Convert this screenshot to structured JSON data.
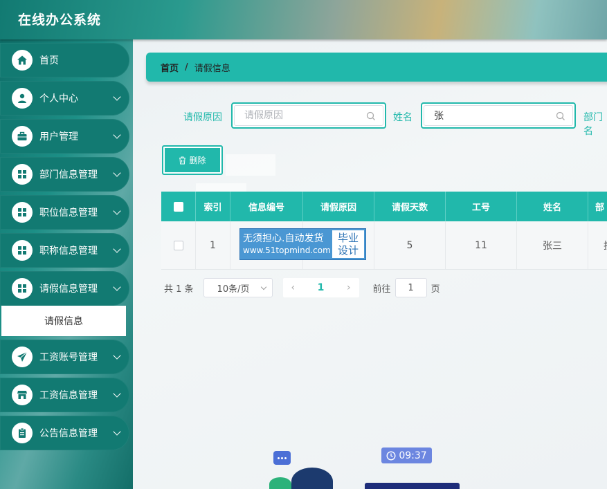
{
  "app": {
    "title": "在线办公系统"
  },
  "sidebar": {
    "items": [
      {
        "label": "首页",
        "icon": "home-icon",
        "has_arrow": false
      },
      {
        "label": "个人中心",
        "icon": "user-icon",
        "has_arrow": true
      },
      {
        "label": "用户管理",
        "icon": "briefcase-icon",
        "has_arrow": true
      },
      {
        "label": "部门信息管理",
        "icon": "grid-icon",
        "has_arrow": true
      },
      {
        "label": "职位信息管理",
        "icon": "grid-icon",
        "has_arrow": true
      },
      {
        "label": "职称信息管理",
        "icon": "grid-icon",
        "has_arrow": true
      },
      {
        "label": "请假信息管理",
        "icon": "grid-icon",
        "has_arrow": true
      },
      {
        "label": "工资账号管理",
        "icon": "paper-plane-icon",
        "has_arrow": true
      },
      {
        "label": "工资信息管理",
        "icon": "store-icon",
        "has_arrow": true
      },
      {
        "label": "公告信息管理",
        "icon": "clipboard-icon",
        "has_arrow": true
      }
    ],
    "active_submenu": "请假信息"
  },
  "breadcrumb": {
    "home": "首页",
    "separator": "/",
    "current": "请假信息"
  },
  "search": {
    "reason_label": "请假原因",
    "reason_placeholder": "请假原因",
    "reason_value": "",
    "name_label": "姓名",
    "name_value": "张",
    "dept_label": "部门名"
  },
  "toolbar": {
    "delete_label": "删除"
  },
  "table": {
    "columns": [
      "索引",
      "信息编号",
      "请假原因",
      "请假天数",
      "工号",
      "姓名",
      "部"
    ],
    "rows": [
      {
        "index": "1",
        "info_no": "",
        "reason": "",
        "days": "5",
        "job_no": "11",
        "name": "张三",
        "dept": "技"
      }
    ]
  },
  "watermark": {
    "line1": "无须担心.自动发货",
    "line2": "www.51topmind.com",
    "right1": "毕业",
    "right2": "设计"
  },
  "pagination": {
    "total": "共 1 条",
    "page_size": "10条/页",
    "current_page": "1",
    "goto_label": "前往",
    "goto_value": "1",
    "page_suffix": "页"
  },
  "illustration": {
    "clock_time": "09:37"
  },
  "colors": {
    "accent": "#21b8ab",
    "sidebar": "#127a72"
  }
}
